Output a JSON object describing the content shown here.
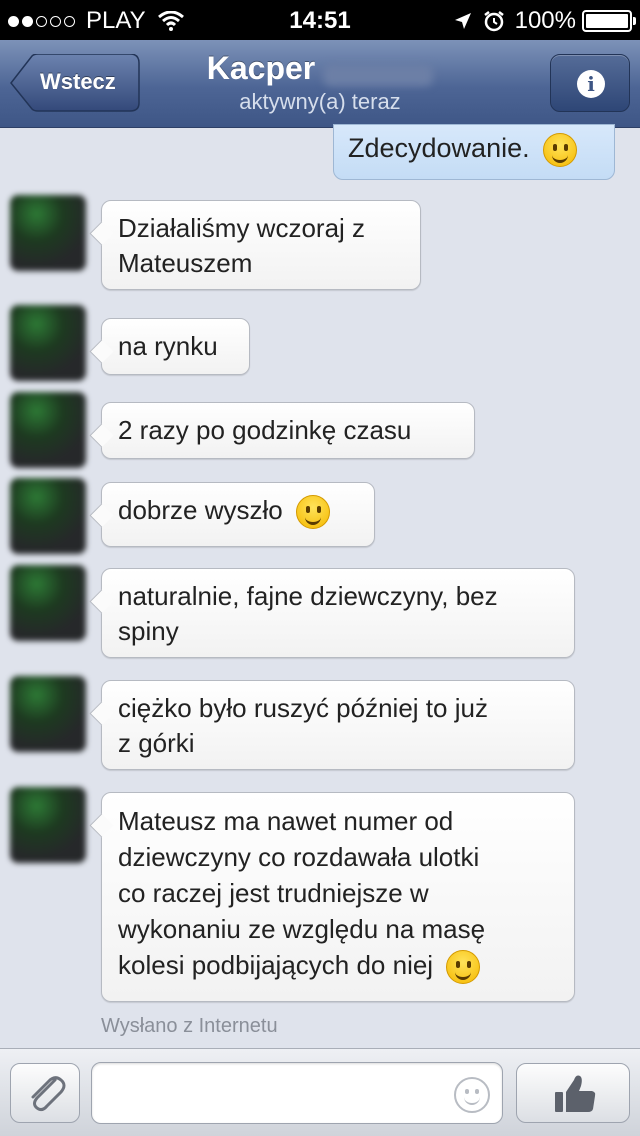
{
  "status_bar": {
    "carrier": "PLAY",
    "time": "14:51",
    "battery": "100%",
    "battery_level": 1.0,
    "signal_bars_filled": 2,
    "signal_bars_total": 5
  },
  "nav": {
    "back_label": "Wstecz",
    "contact_name": "Kacper",
    "status": "aktywny(a) teraz",
    "info_glyph": "i"
  },
  "messages": {
    "outgoing": [
      {
        "text": "Zdecydowanie.",
        "emoji": "smiling-face-icon"
      }
    ],
    "incoming": [
      {
        "lines": [
          "Działaliśmy wczoraj z",
          "Mateuszem"
        ]
      },
      {
        "lines": [
          "na rynku"
        ]
      },
      {
        "lines": [
          "2 razy po godzinkę czasu"
        ]
      },
      {
        "lines": [
          "dobrze wyszło"
        ],
        "emoji": "grinning-face-icon"
      },
      {
        "lines": [
          "naturalnie, fajne dziewczyny, bez",
          "spiny"
        ]
      },
      {
        "lines": [
          "ciężko było ruszyć później to już",
          "z górki"
        ]
      },
      {
        "lines": [
          "Mateusz ma nawet numer od",
          "dziewczyny co rozdawała ulotki",
          "co raczej jest trudniejsze w",
          "wykonaniu ze względu na masę",
          "kolesi podbijających do niej"
        ],
        "emoji": "winking-tongue-face-icon"
      }
    ],
    "sent_note": "Wysłano z Internetu"
  },
  "composer": {
    "value": "",
    "attach_icon": "paperclip-icon",
    "emoji_icon": "smiley-icon",
    "like_icon": "thumbs-up-icon"
  },
  "colors": {
    "nav_bar": "#4d6595",
    "background": "#dfe3ec",
    "outgoing_bubble": "#c4dcf5",
    "incoming_bubble": "#ffffff"
  }
}
